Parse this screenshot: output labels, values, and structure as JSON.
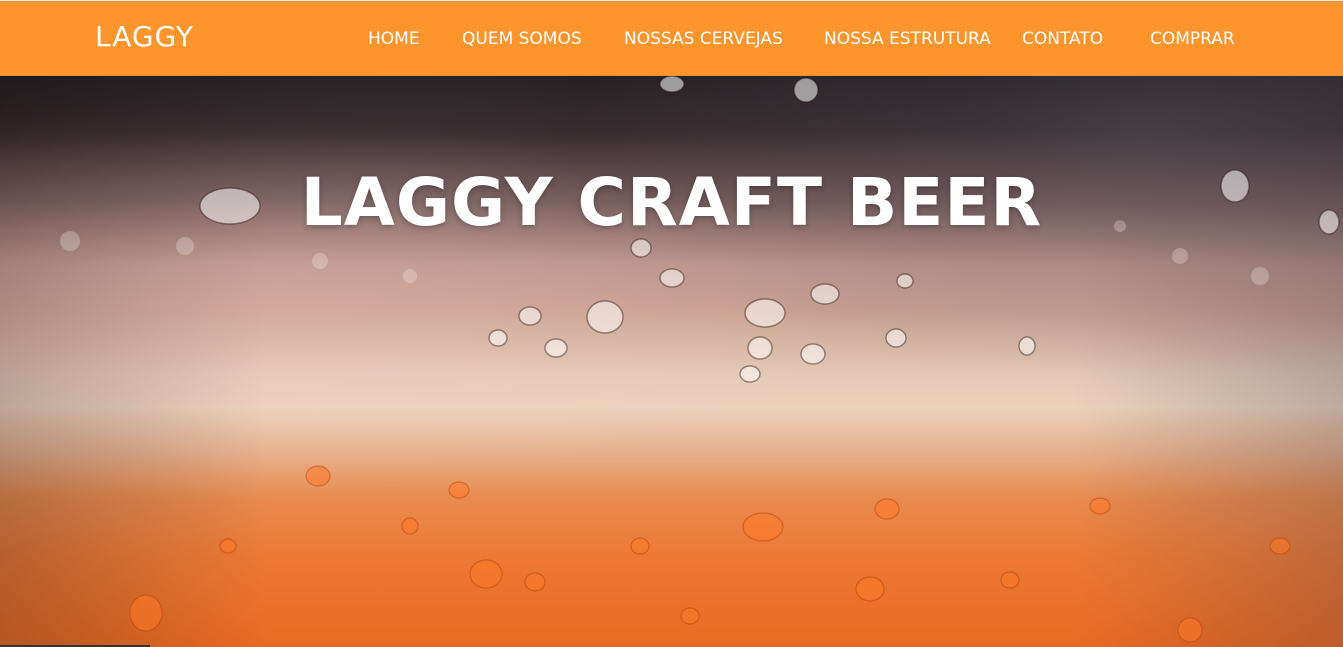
{
  "header": {
    "logo": "LAGGY",
    "nav": [
      {
        "label": "HOME"
      },
      {
        "label": "QUEM SOMOS"
      },
      {
        "label": "NOSSAS CERVEJAS"
      },
      {
        "label": "NOSSA ESTRUTURA"
      },
      {
        "label": "CONTATO"
      },
      {
        "label": "COMPRAR"
      }
    ],
    "background_color": "#fd952c"
  },
  "hero": {
    "title": "LAGGY CRAFT BEER",
    "background_image": "beer-glass-with-condensation-droplets"
  }
}
